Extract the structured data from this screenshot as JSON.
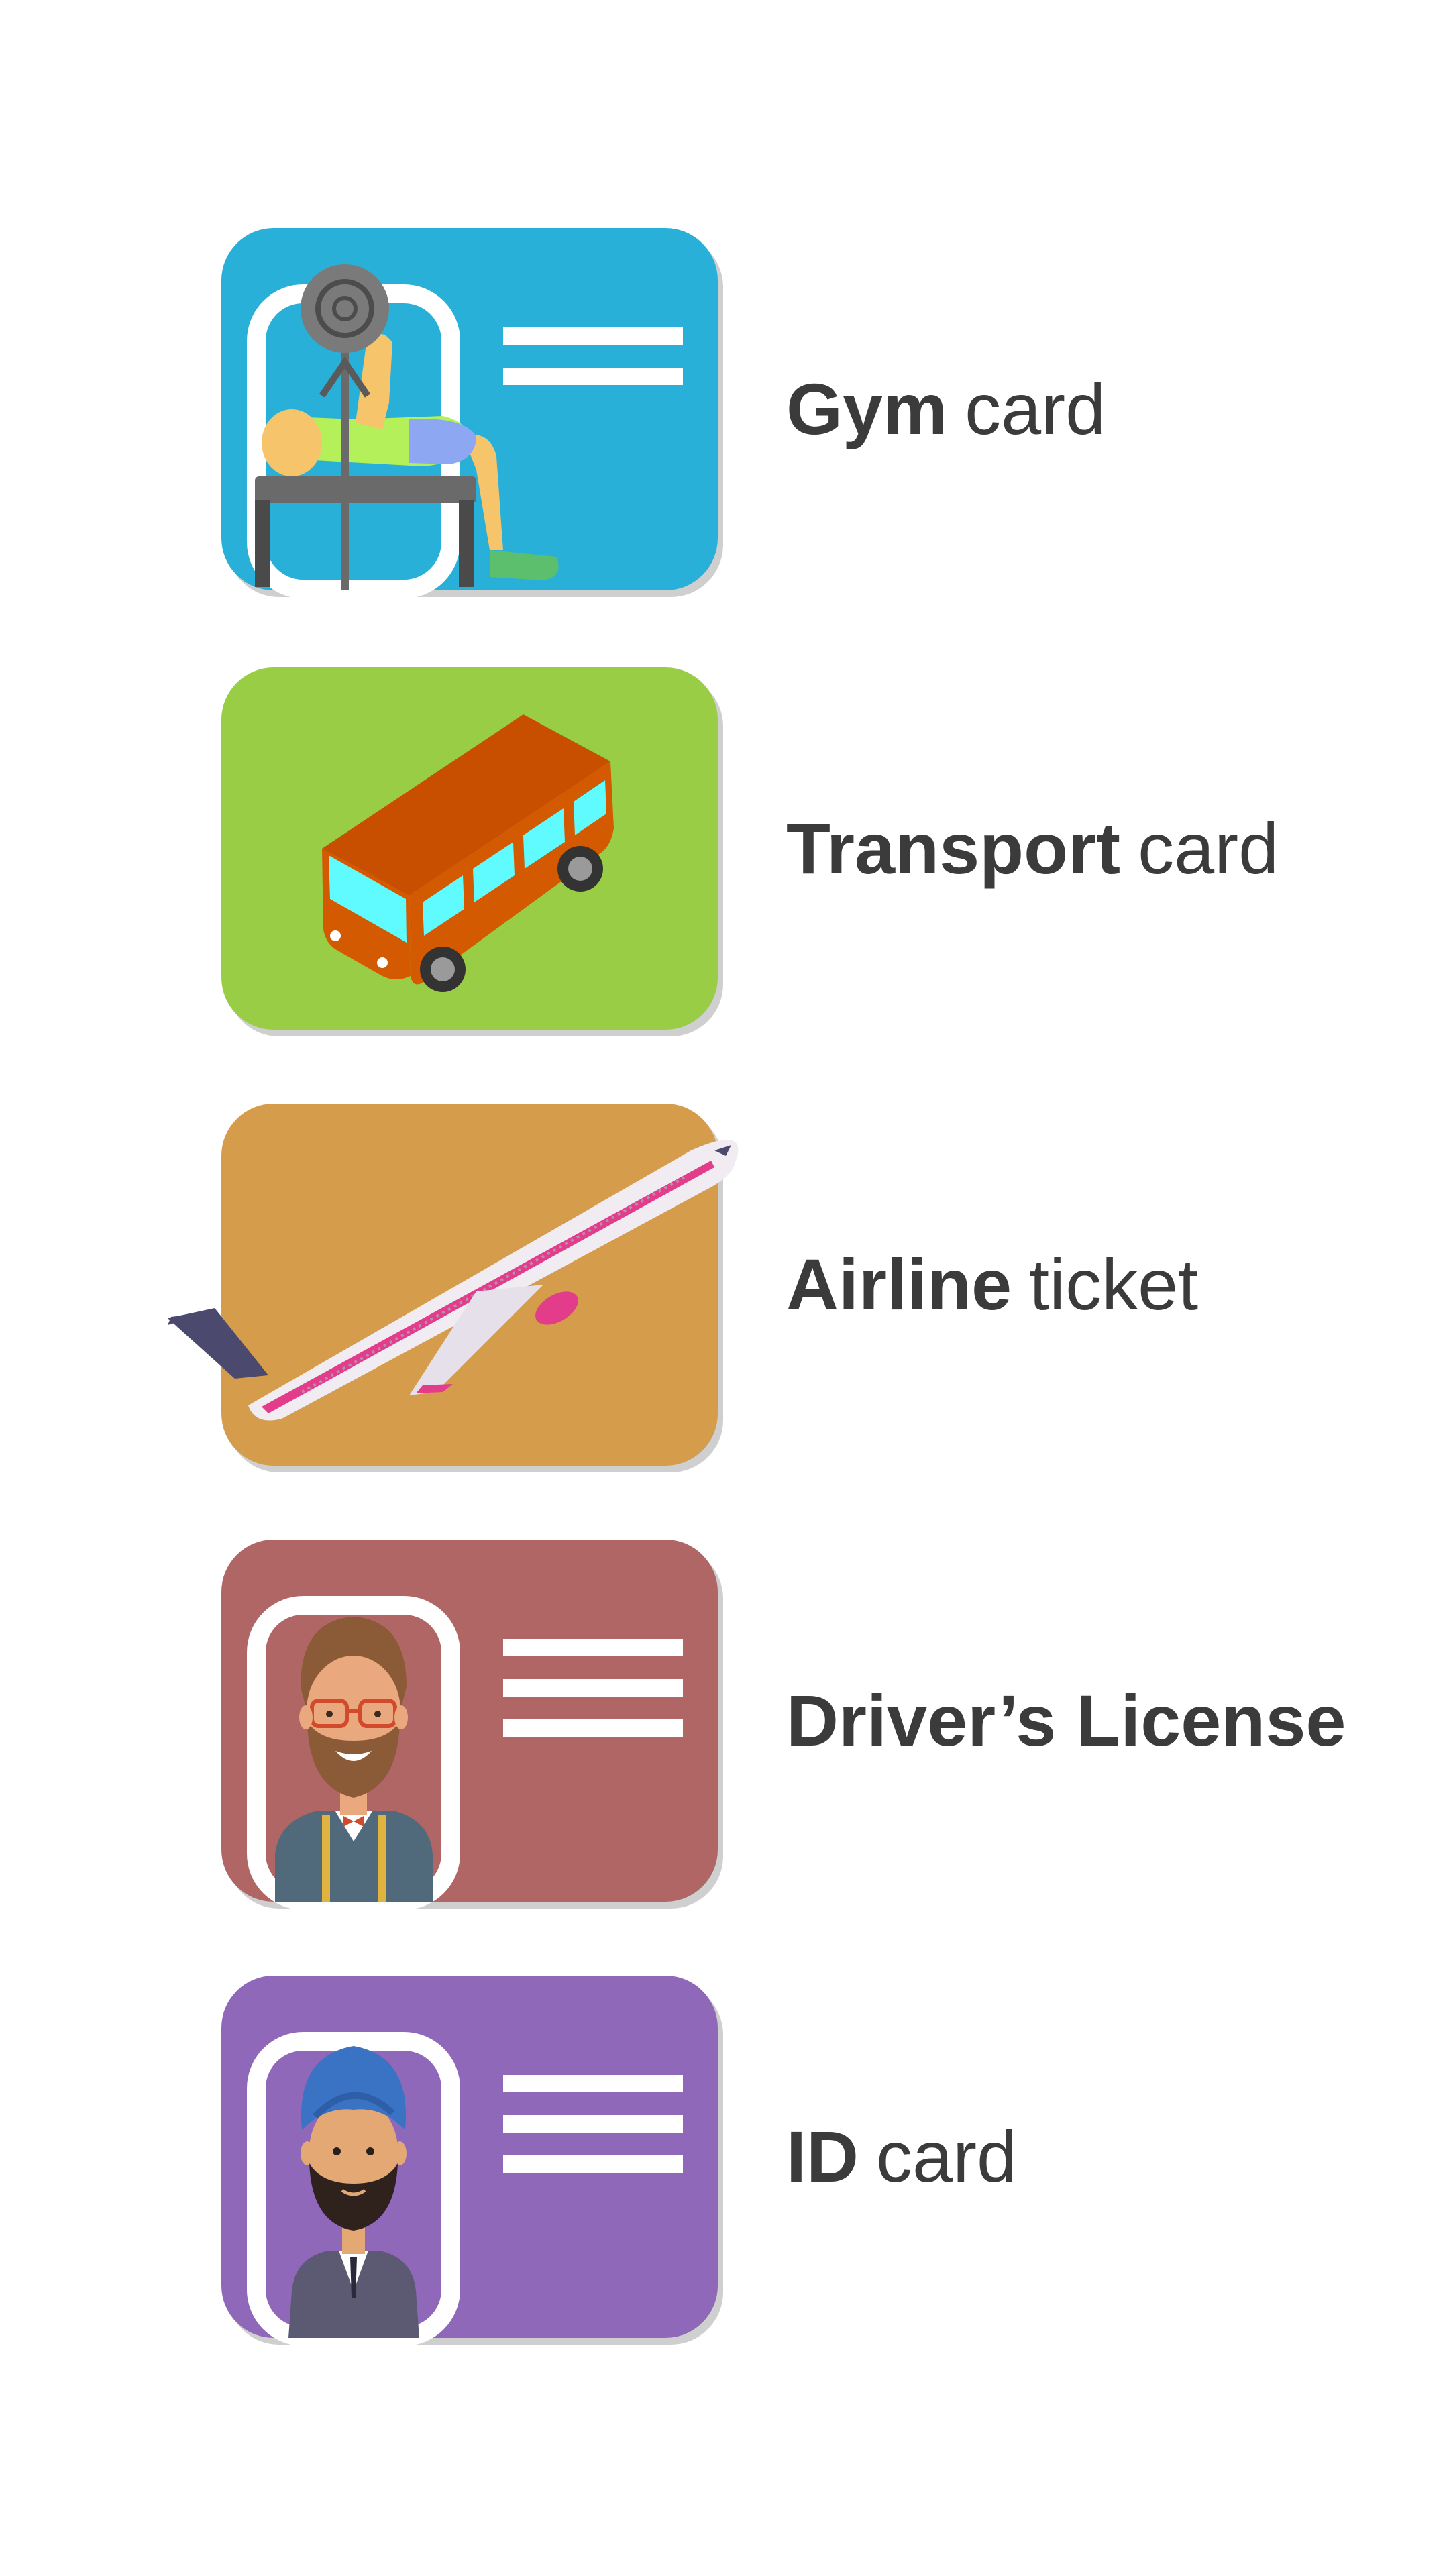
{
  "items": [
    {
      "strong": "Gym",
      "light": "card",
      "color": "#29b0d9",
      "icon": "weightlifter-icon"
    },
    {
      "strong": "Transport",
      "light": "card",
      "color": "#98cd45",
      "icon": "bus-icon"
    },
    {
      "strong": "Airline",
      "light": "ticket",
      "color": "#d59c4c",
      "icon": "airplane-icon"
    },
    {
      "strong": "Driver’s License",
      "light": "",
      "color": "#b06664",
      "icon": "bearded-man-glasses-icon"
    },
    {
      "strong": "ID",
      "light": "card",
      "color": "#9068ba",
      "icon": "turbaned-man-icon"
    }
  ]
}
